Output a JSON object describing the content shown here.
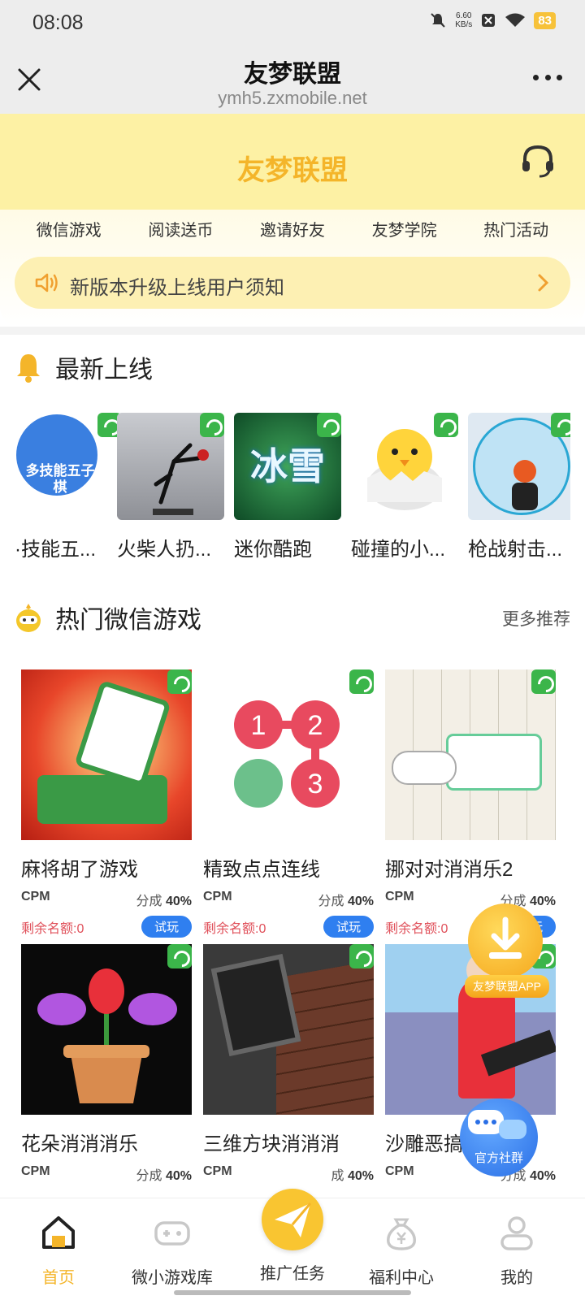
{
  "status_bar": {
    "time": "08:08",
    "net_speed": "6.60",
    "net_unit": "KB/s",
    "battery": "83"
  },
  "title_bar": {
    "title": "友梦联盟",
    "url": "ymh5.zxmobile.net"
  },
  "header": {
    "brand": "友梦联盟"
  },
  "top_nav": [
    "微信游戏",
    "阅读送币",
    "邀请好友",
    "友梦学院",
    "热门活动"
  ],
  "notice": {
    "text": "新版本升级上线用户须知"
  },
  "newest": {
    "title": "最新上线",
    "items": [
      {
        "name": "·技能五...",
        "thumb_text": "多技能五子棋"
      },
      {
        "name": "火柴人扔..."
      },
      {
        "name": "迷你酷跑",
        "thumb_text": "冰雪"
      },
      {
        "name": "碰撞的小..."
      },
      {
        "name": "枪战射击..."
      }
    ]
  },
  "hot": {
    "title": "热门微信游戏",
    "more": "更多推荐",
    "games": [
      {
        "name": "麻将胡了游戏",
        "cpm": "CPM",
        "share_label": "分成",
        "share": "40%",
        "quota": "剩余名额:0",
        "try": "试玩"
      },
      {
        "name": "精致点点连线",
        "cpm": "CPM",
        "share_label": "分成",
        "share": "40%",
        "quota": "剩余名额:0",
        "try": "试玩"
      },
      {
        "name": "挪对对消消乐2",
        "cpm": "CPM",
        "share_label": "分成",
        "share": "40%",
        "quota": "剩余名额:0",
        "try": "试玩"
      },
      {
        "name": "花朵消消消乐",
        "cpm": "CPM",
        "share_label": "分成",
        "share": "40%"
      },
      {
        "name": "三维方块消消消",
        "cpm": "CPM",
        "share_label": "成",
        "share": "40%"
      },
      {
        "name": "沙雕恶搞",
        "cpm": "CPM",
        "share_label": "分成",
        "share": "40%"
      }
    ]
  },
  "float_app": {
    "label": "友梦联盟APP"
  },
  "float_group": {
    "label": "官方社群"
  },
  "tabs": [
    {
      "label": "首页",
      "icon": "home-icon",
      "active": true
    },
    {
      "label": "微小游戏库",
      "icon": "gamepad-icon"
    },
    {
      "label": "推广任务",
      "icon": "paper-plane-icon"
    },
    {
      "label": "福利中心",
      "icon": "money-bag-icon"
    },
    {
      "label": "我的",
      "icon": "user-icon"
    }
  ],
  "colors": {
    "accent": "#f4b52a",
    "header_bg": "#fdf1a4",
    "try_button": "#2f7ff0",
    "quota": "#e0505a"
  }
}
